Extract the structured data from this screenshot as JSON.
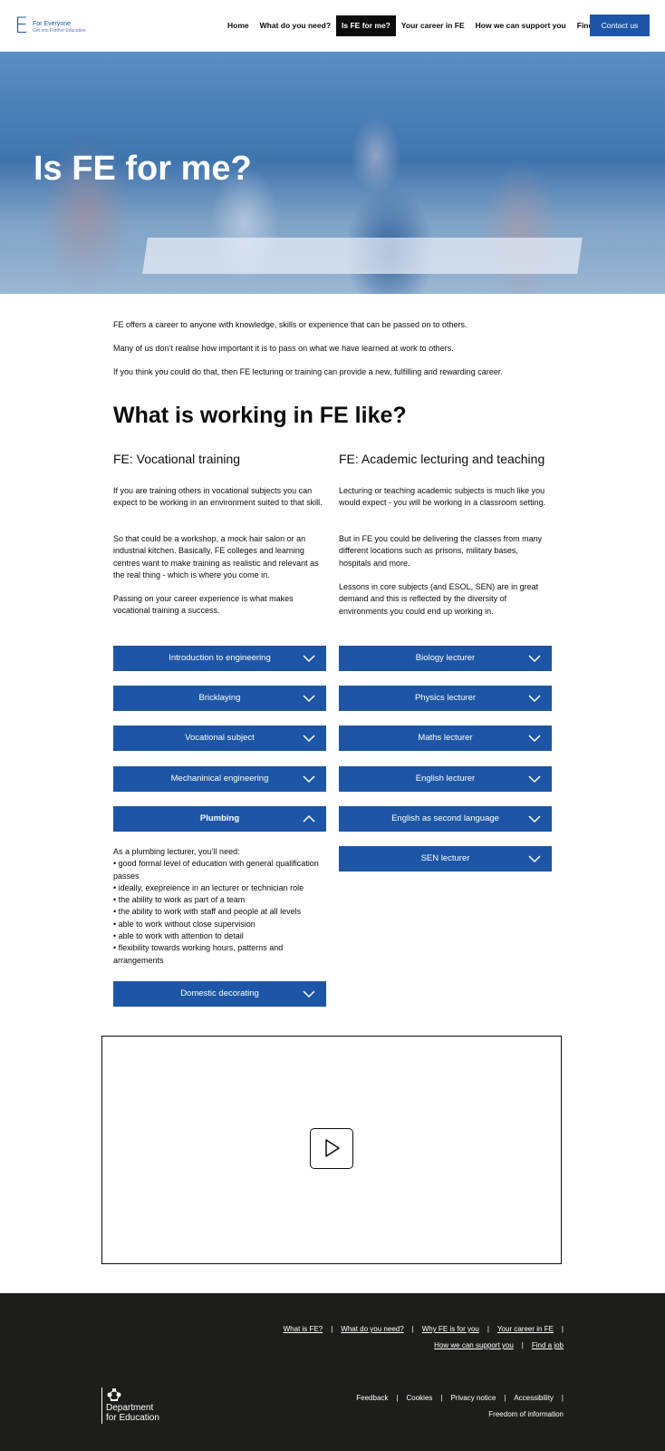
{
  "header": {
    "logo_letter": "E",
    "logo_title": "For Everyone",
    "logo_subtitle": "Get into Further Education",
    "nav": [
      "Home",
      "What do you need?",
      "Is FE for me?",
      "Your career in FE",
      "How we can support you",
      "Find a job"
    ],
    "active_nav": "Is FE for me?",
    "contact_label": "Contact us",
    "brand_color": "#1d56a6"
  },
  "hero": {
    "title": "Is FE for me?"
  },
  "intro": [
    "FE offers a career to anyone with knowledge, skills or experience that can be passed on to others.",
    "Many of us don’t realise how important it is to pass on what we have learned at work to others.",
    "If you think you could do that, then FE lecturing or training can provide a new, fulfilling and rewarding career."
  ],
  "section": {
    "title": "What is working in FE like?",
    "vocational": {
      "title": "FE: Vocational training",
      "paragraphs": [
        "If you are training others in vocational subjects you can expect to be working in an environment suited to that skill.",
        "So that could be a workshop, a mock hair salon or an industrial kitchen. Basically, FE colleges and learning centres want to make  training as realistic and relevant as the real thing - which is where you come in.",
        "Passing on your career experience is what makes vocational training a success."
      ],
      "accordions": [
        "Introduction to engineering",
        "Bricklaying",
        "Vocational subject",
        "Mechaninical engineering",
        "Plumbing",
        "Domestic decorating"
      ]
    },
    "academic": {
      "title": "FE: Academic lecturing and teaching",
      "paragraphs": [
        "Lecturing or teaching academic subjects is much like you would expect - you will be working in a classroom setting.",
        "But in FE you could be delivering the classes from many different locations such as prisons, military bases, hospitals and more.",
        "Lessons in core subjects (and ESOL, SEN) are in great demand and this is reflected by the diversity of environments you could end up working in."
      ],
      "accordions": [
        "Biology lecturer",
        "Physics lecturer",
        "Maths lecturer",
        "English lecturer",
        "English as second language",
        "SEN lecturer"
      ]
    },
    "plumbing_details": {
      "intro": "As a plumbing lecturer, you’ll need:",
      "items": [
        "• good formal level of education with general qualification passes",
        "• ideally, exepreience in an lecturer or technician role",
        "• the ability to work as part of a team",
        "• the ability to work with staff and people at all levels",
        "• able to work without close supervision",
        "• able to work with attention to detail",
        "• flexibility towards working hours, patterns and arrangements"
      ]
    }
  },
  "video": {
    "icon": "play-icon"
  },
  "footer": {
    "links_row1": [
      "What is FE?",
      "What do you need?",
      "Why FE is for you",
      "Your career in FE"
    ],
    "links_row2": [
      "How we can support you",
      "Find a job"
    ],
    "links_row3": [
      "Feedback",
      "Cookies",
      "Privacy notice",
      "Accessibility"
    ],
    "links_row4": [
      "Freedom of information"
    ],
    "dfe_line1": "Department",
    "dfe_line2": "for Education"
  }
}
